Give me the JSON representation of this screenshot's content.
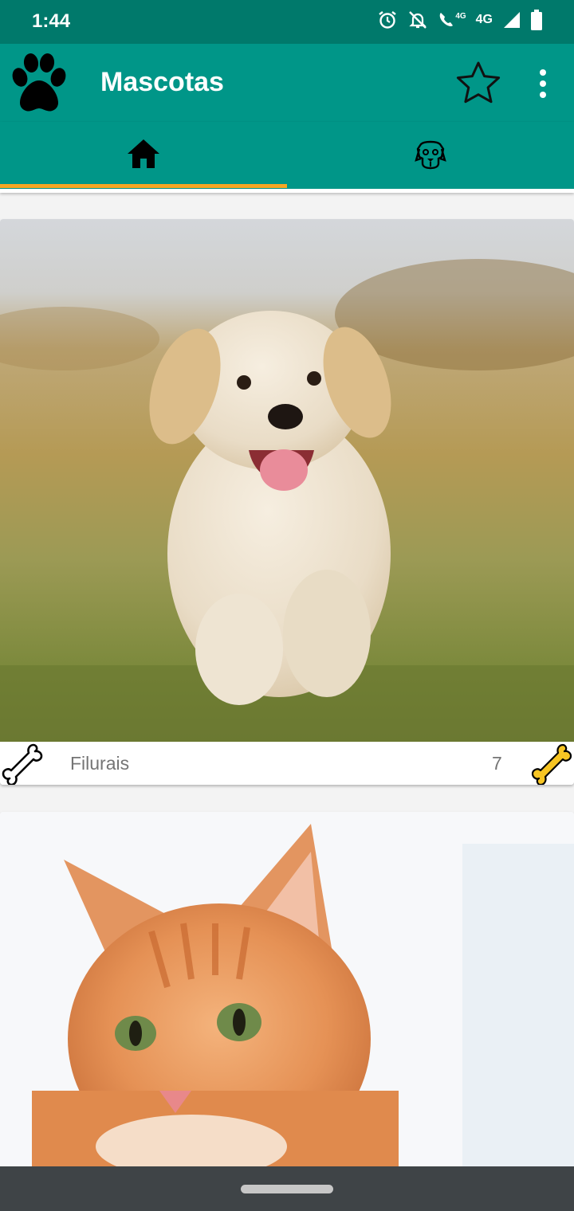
{
  "status_bar": {
    "time": "1:44",
    "network": "4G",
    "call_network": "4G",
    "icons": [
      "alarm-icon",
      "notifications-off-icon",
      "wifi-calling-icon",
      "signal-icon",
      "battery-icon"
    ]
  },
  "app_bar": {
    "title": "Mascotas",
    "logo_icon": "paw-icon",
    "actions": [
      "star-outline-icon",
      "more-vert-icon"
    ],
    "background": "#009688"
  },
  "tabs": [
    {
      "icon": "home-icon",
      "selected": true
    },
    {
      "icon": "dog-face-icon",
      "selected": false
    }
  ],
  "accent_color": "#f5a623",
  "pets": [
    {
      "name": "Filurais",
      "likes": "7",
      "photo": "puppy running on grass"
    },
    {
      "name": "",
      "likes": "",
      "photo": "orange tabby cat"
    }
  ]
}
